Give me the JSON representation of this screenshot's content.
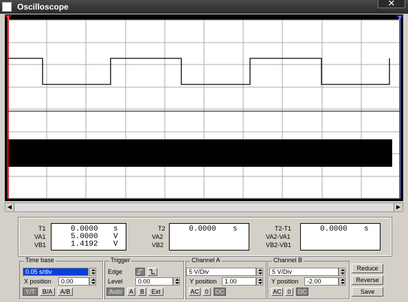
{
  "window": {
    "title": "Oscilloscope",
    "close_glyph": "✕"
  },
  "colors": {
    "screen_bg": "#000000",
    "grid": "#808080",
    "trace_a": "#000000",
    "marker_1": "#ff0000",
    "marker_2": "#0000ff"
  },
  "screen": {
    "marker_1_label": "1",
    "marker_2_label": "2"
  },
  "readouts": {
    "t1": {
      "label": "T1",
      "value": "0.0000",
      "unit": "s"
    },
    "va1": {
      "label": "VA1",
      "value": "5.0000",
      "unit": "V"
    },
    "vb1": {
      "label": "VB1",
      "value": "1.4192",
      "unit": "V"
    },
    "t2": {
      "label": "T2",
      "value": "0.0000",
      "unit": "s"
    },
    "va2": {
      "label": "VA2"
    },
    "vb2": {
      "label": "VB2"
    },
    "t2t1": {
      "label": "T2-T1",
      "value": "0.0000",
      "unit": "s"
    },
    "va2va1": {
      "label": "VA2-VA1"
    },
    "vb2vb1": {
      "label": "VB2-VB1"
    }
  },
  "time_base": {
    "title": "Time base",
    "scale": "0.05 s/div",
    "x_position_label": "X position",
    "x_position": "0.00",
    "modes": [
      "Y/T",
      "B/A",
      "A/B"
    ]
  },
  "trigger": {
    "title": "Trigger",
    "edge_label": "Edge",
    "level_label": "Level",
    "level": "0.00",
    "sources": [
      "Auto",
      "A",
      "B",
      "Ext"
    ]
  },
  "channel_a": {
    "title": "Channel A",
    "scale": "5 V/Div",
    "y_position_label": "Y position",
    "y_position": "1.00",
    "coupling": [
      "AC",
      "0",
      "DC"
    ]
  },
  "channel_b": {
    "title": "Channel B",
    "scale": "5 V/Div",
    "y_position_label": "Y position",
    "y_position": "-2.00",
    "coupling": [
      "AC",
      "0",
      "DC"
    ]
  },
  "actions": {
    "reduce": "Reduce",
    "reverse": "Reverse",
    "save": "Save"
  }
}
